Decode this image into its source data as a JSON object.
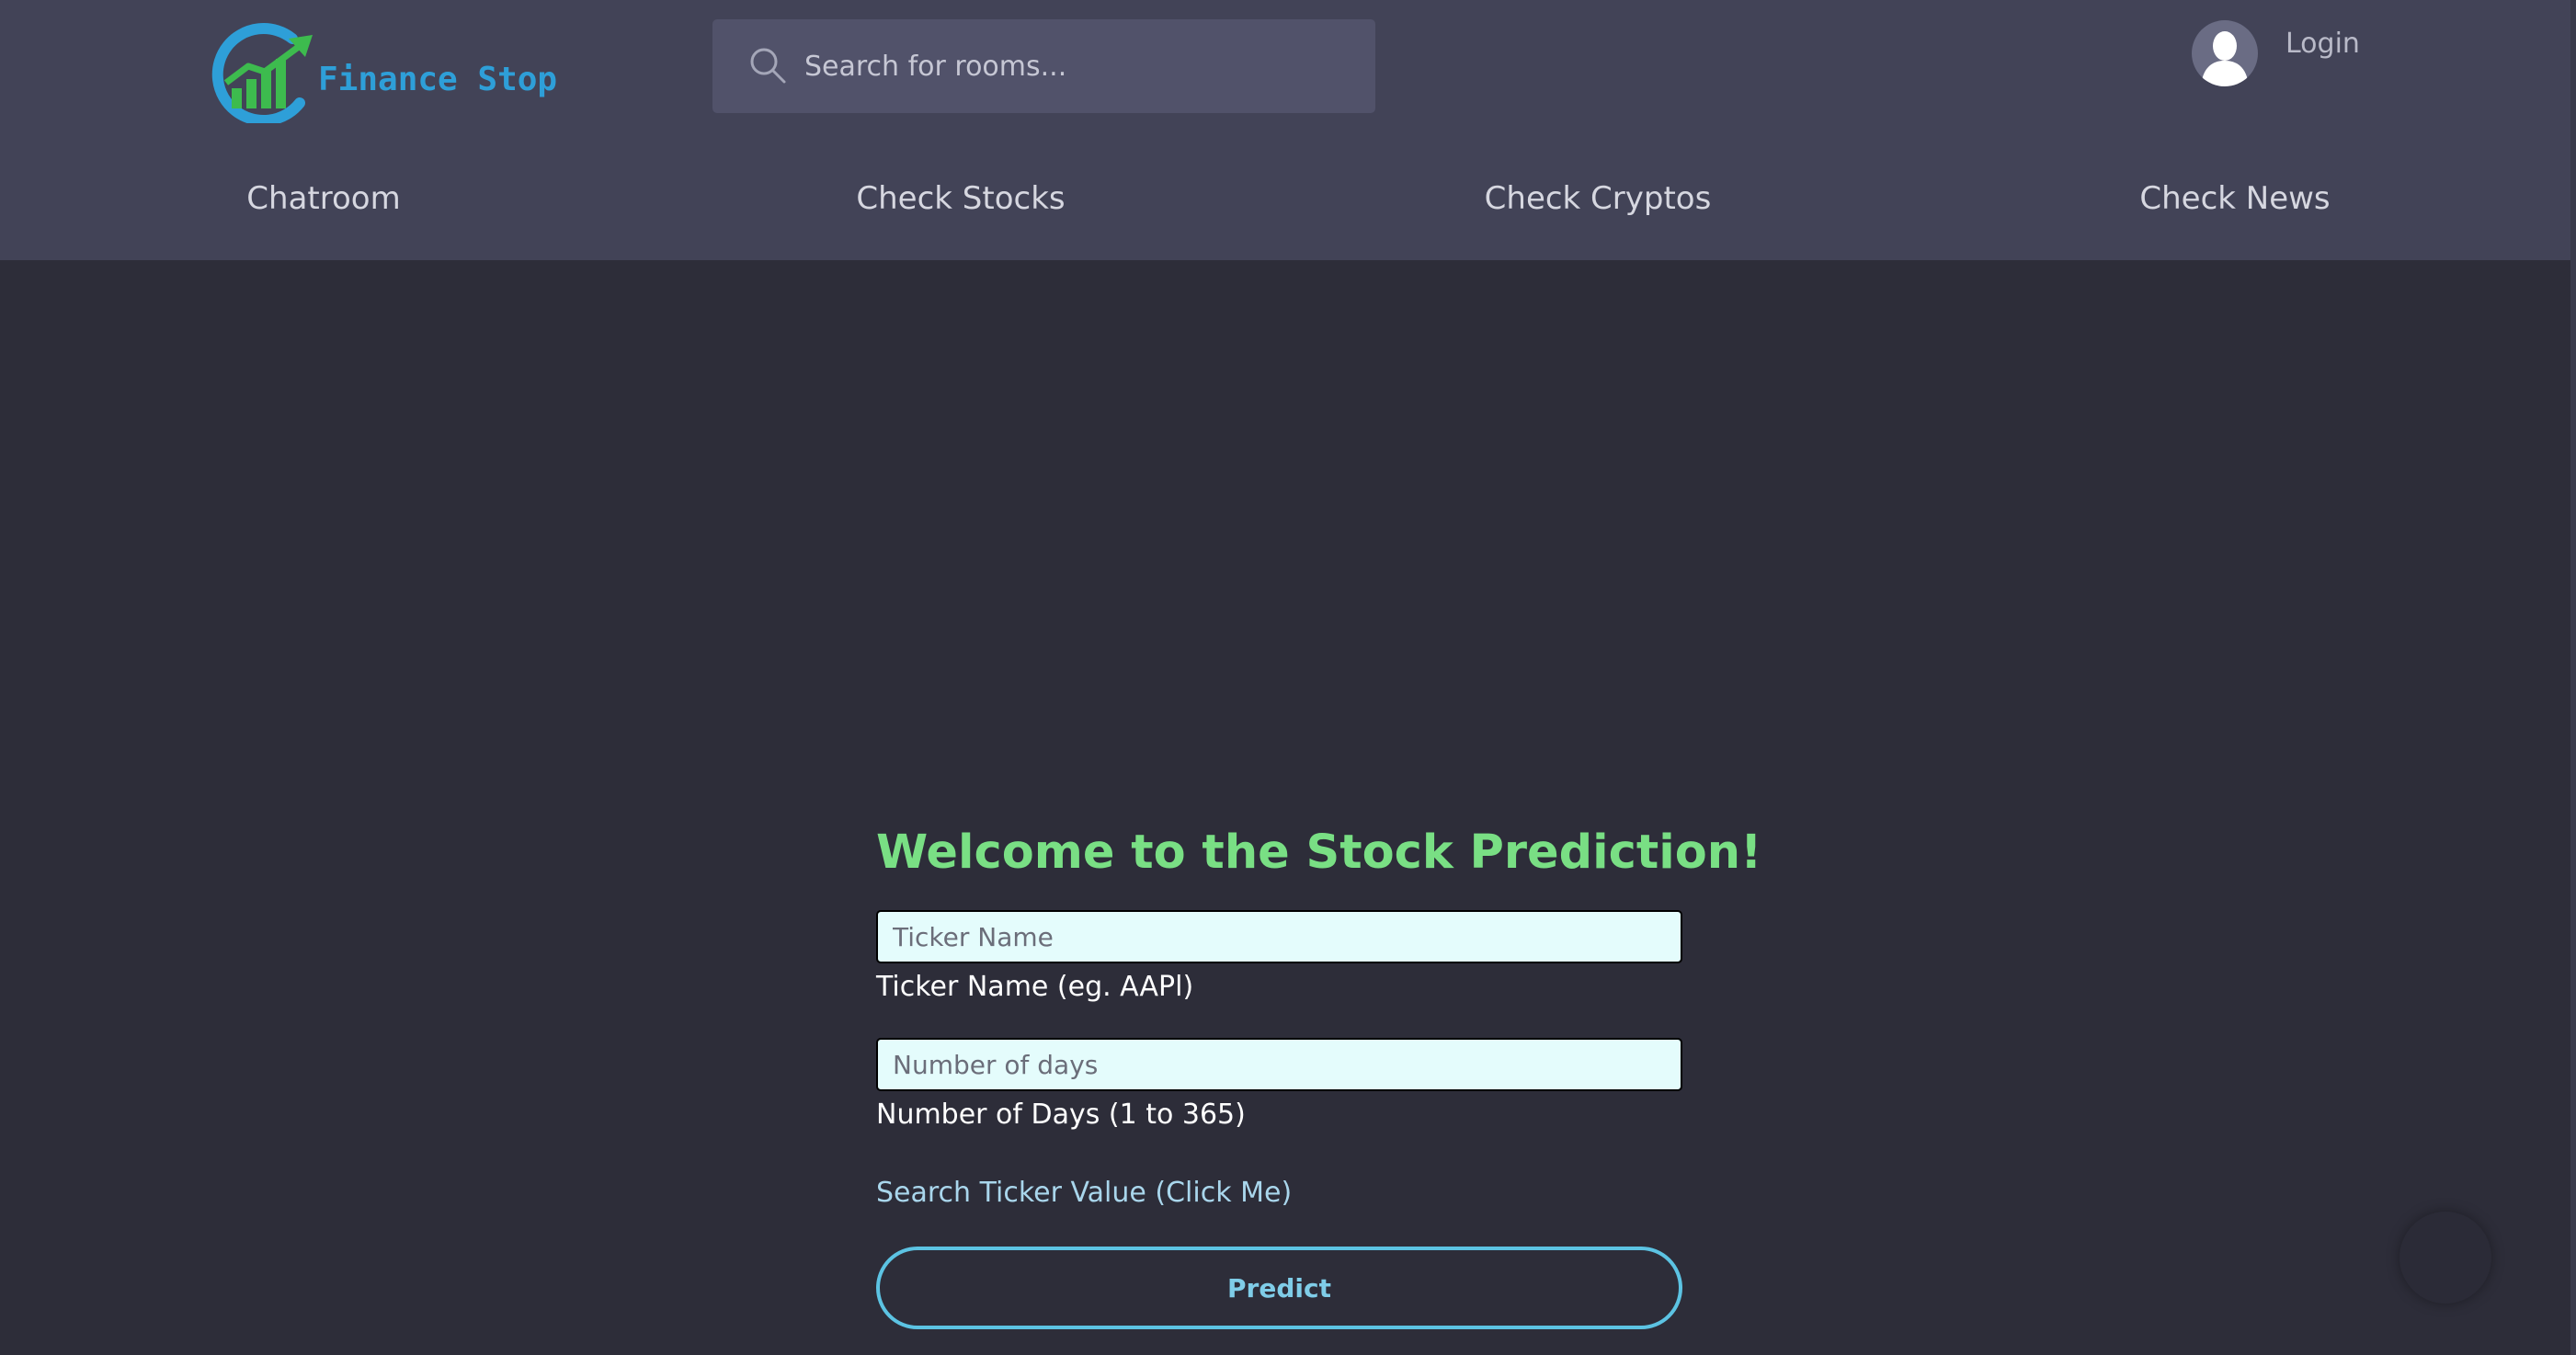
{
  "header": {
    "logo_text": "Finance Stop",
    "search_placeholder": "Search for rooms...",
    "login_label": "Login"
  },
  "nav": {
    "items": [
      "Chatroom",
      "Check Stocks",
      "Check Cryptos",
      "Check News"
    ]
  },
  "main": {
    "heading": "Welcome to the Stock Prediction!",
    "ticker_placeholder": "Ticker Name",
    "ticker_label": "Ticker Name (eg. AAPl)",
    "days_placeholder": "Number of days",
    "days_label": "Number of Days (1 to 365)",
    "search_link": "Search Ticker Value (Click Me)",
    "predict_button": "Predict"
  },
  "colors": {
    "header_bg": "#424357",
    "page_bg": "#2d2d39",
    "heading": "#79df84",
    "accent": "#5cc3e3",
    "logo": "#2e9fd8"
  },
  "icons": [
    "logo-icon",
    "search-icon",
    "user-avatar-icon"
  ]
}
